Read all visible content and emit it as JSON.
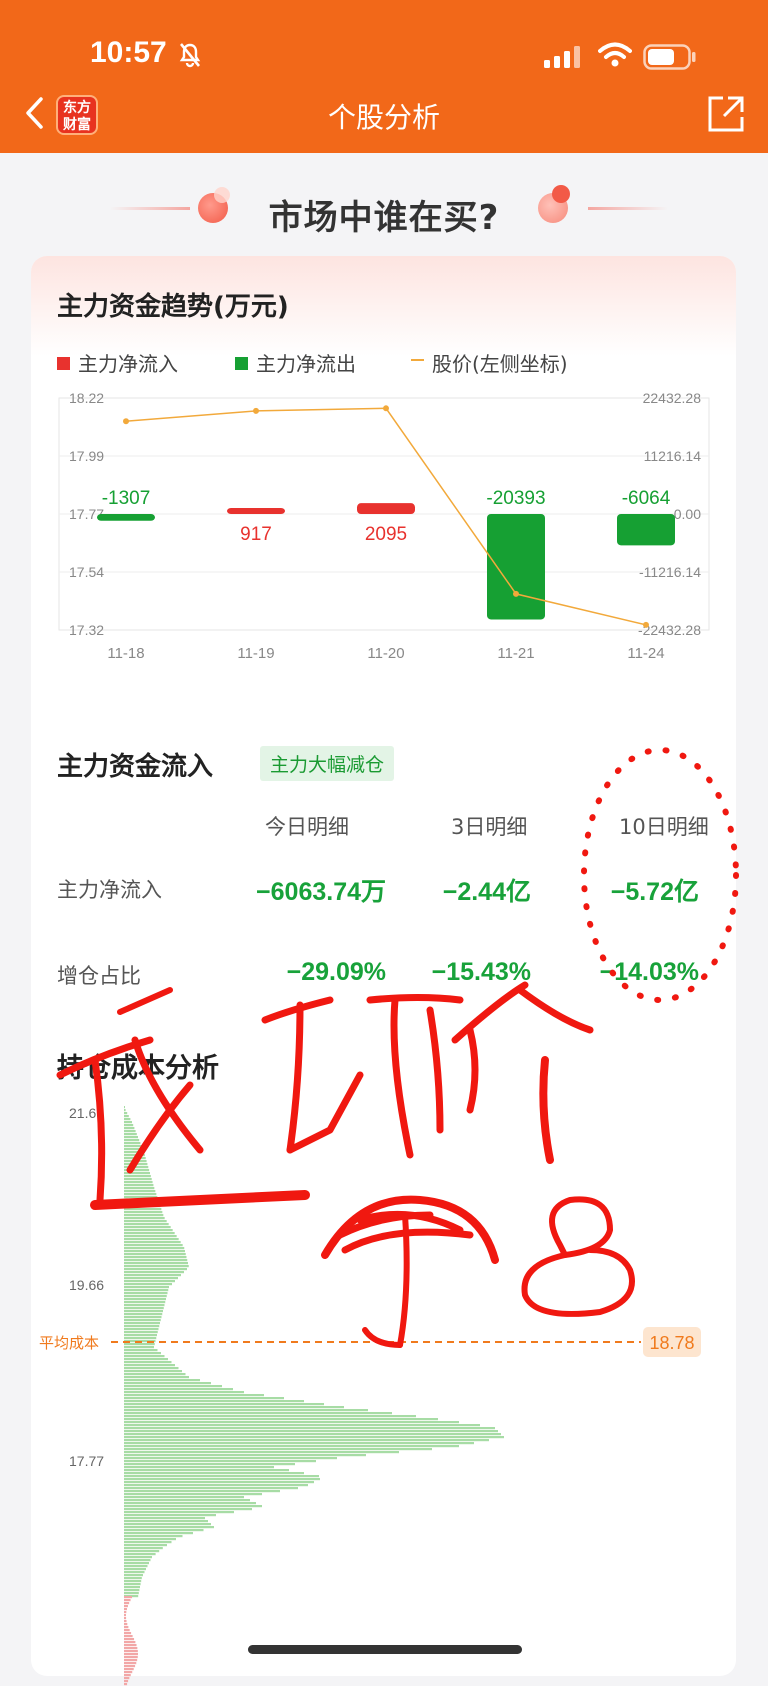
{
  "status": {
    "time": "10:57"
  },
  "header": {
    "logo_text_line1": "东方",
    "logo_text_line2": "财富",
    "title": "个股分析"
  },
  "section": {
    "title": "市场中谁在买?"
  },
  "trend": {
    "title": "主力资金趋势(万元)",
    "legend": {
      "inflow": "主力净流入",
      "outflow": "主力净流出",
      "price": "股价(左侧坐标)"
    }
  },
  "chart_data": {
    "type": "bar",
    "categories": [
      "11-18",
      "11-19",
      "11-20",
      "11-21",
      "11-24"
    ],
    "series": [
      {
        "name": "主力净流入/主力净流出",
        "values": [
          -1307,
          917,
          2095,
          -20393,
          -6064
        ]
      },
      {
        "name": "股价(左侧坐标)",
        "values": [
          18.13,
          18.17,
          18.18,
          17.46,
          17.34
        ]
      }
    ],
    "data_labels": [
      "-1307",
      "917",
      "2095",
      "-20393",
      "-6064"
    ],
    "left_ticks": [
      "18.22",
      "17.99",
      "17.77",
      "17.54",
      "17.32"
    ],
    "right_ticks": [
      "22432.28",
      "11216.14",
      "0.00",
      "-11216.14",
      "-22432.28"
    ],
    "ylim_left": [
      17.32,
      18.22
    ],
    "ylim_right": [
      -22432.28,
      22432.28
    ],
    "colors": {
      "inflow": "#e8322e",
      "outflow": "#16a033",
      "price": "#f2a93b"
    }
  },
  "flow": {
    "title": "主力资金流入",
    "badge": "主力大幅减仓",
    "cols": [
      "今日明细",
      "3日明细",
      "10日明细"
    ],
    "rows": [
      {
        "label": "主力净流入",
        "values": [
          "−6063.74万",
          "−2.44亿",
          "−5.72亿"
        ]
      },
      {
        "label": "增仓占比",
        "values": [
          "−29.09%",
          "−15.43%",
          "−14.03%"
        ]
      }
    ]
  },
  "holding": {
    "title": "持仓成本分析",
    "ticks": [
      "21.6",
      "19.66",
      "17.77"
    ],
    "avg_label": "平均成本",
    "avg_value": "18.78"
  }
}
